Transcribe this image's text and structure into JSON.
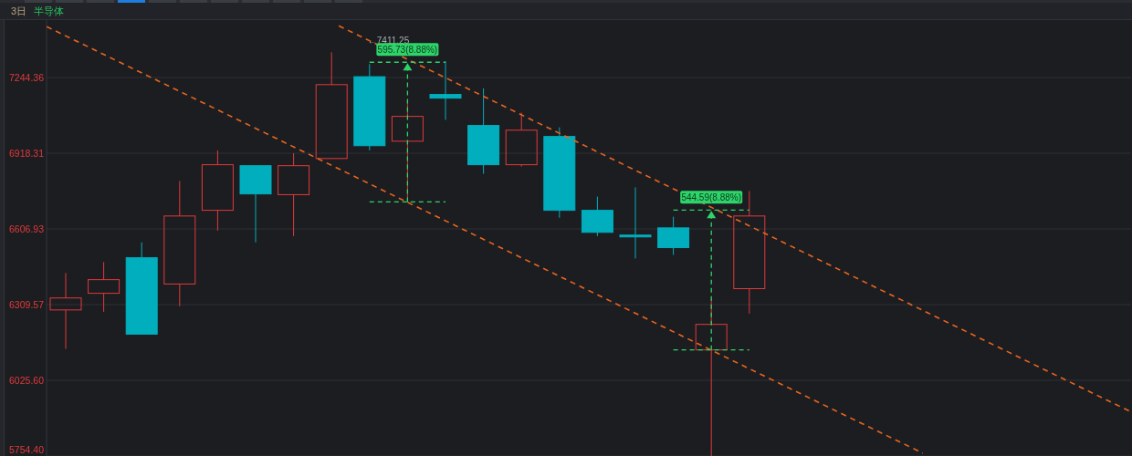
{
  "top_tabs": [
    {
      "selected": false
    },
    {
      "selected": false
    },
    {
      "selected": false
    },
    {
      "selected": true
    },
    {
      "selected": false
    },
    {
      "selected": false
    },
    {
      "selected": false
    },
    {
      "selected": false
    },
    {
      "selected": false
    },
    {
      "selected": false
    },
    {
      "selected": false
    }
  ],
  "header": {
    "period": "3日",
    "name": "半导体"
  },
  "price_axis": [
    "7244.36",
    "6918.31",
    "6606.93",
    "6309.57",
    "6025.60",
    "5754.40"
  ],
  "high_marker": "←7411.25",
  "measurements": [
    "595.73(8.88%)",
    "544.59(8.88%)"
  ]
}
